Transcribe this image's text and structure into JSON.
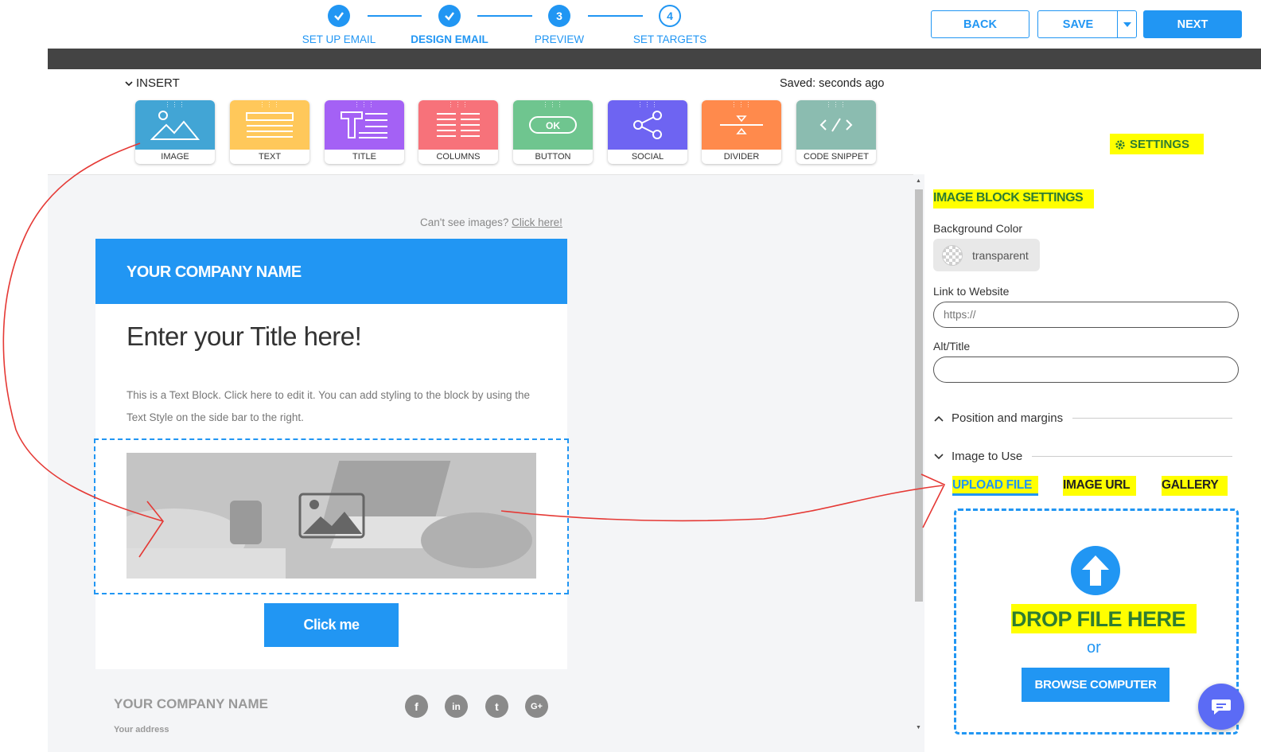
{
  "stepper": {
    "steps": [
      {
        "number": "",
        "label": "SET UP EMAIL",
        "state": "done"
      },
      {
        "number": "",
        "label": "DESIGN EMAIL",
        "state": "current"
      },
      {
        "number": "3",
        "label": "PREVIEW",
        "state": "upcoming"
      },
      {
        "number": "4",
        "label": "SET TARGETS",
        "state": "upcoming"
      }
    ]
  },
  "top_buttons": {
    "back": "BACK",
    "save": "SAVE",
    "next": "NEXT"
  },
  "insert": {
    "toggle_label": "INSERT",
    "saved_status": "Saved: seconds ago",
    "settings_label": "SETTINGS",
    "blocks": [
      {
        "label": "IMAGE",
        "color": "#42A5D5",
        "icon": "image-icon"
      },
      {
        "label": "TEXT",
        "color": "#FFC85A",
        "icon": "text-icon"
      },
      {
        "label": "TITLE",
        "color": "#A461F5",
        "icon": "title-icon"
      },
      {
        "label": "COLUMNS",
        "color": "#F7727A",
        "icon": "columns-icon"
      },
      {
        "label": "BUTTON",
        "color": "#6FC58F",
        "icon": "button-icon"
      },
      {
        "label": "SOCIAL",
        "color": "#6E64F2",
        "icon": "share-icon"
      },
      {
        "label": "DIVIDER",
        "color": "#FF8A4C",
        "icon": "divider-icon"
      },
      {
        "label": "CODE SNIPPET",
        "color": "#8BBCB0",
        "icon": "code-icon"
      }
    ]
  },
  "email": {
    "cant_see": "Can't see images?",
    "click_here": "Click here!",
    "company_name": "YOUR COMPANY NAME",
    "title": "Enter your Title here!",
    "text_block": "This is a Text Block. Click here to edit it. You can add styling to the block by using the Text Style on the side bar to the right.",
    "button_label": "Click me",
    "footer_company": "YOUR COMPANY NAME",
    "footer_address": "Your address",
    "footer_social": [
      "f",
      "in",
      "t",
      "G+"
    ]
  },
  "panel": {
    "title": "IMAGE BLOCK SETTINGS",
    "bg_color_label": "Background Color",
    "bg_color_value": "transparent",
    "link_label": "Link to Website",
    "link_placeholder": "https://",
    "alt_label": "Alt/Title",
    "alt_value": "",
    "position_section": "Position and margins",
    "image_section": "Image to Use",
    "tabs": [
      "UPLOAD FILE",
      "IMAGE URL",
      "GALLERY"
    ],
    "drop_text": "DROP FILE HERE",
    "or_text": "or",
    "browse_label": "BROWSE COMPUTER"
  },
  "colors": {
    "accent": "#2196F3",
    "highlight": "#FFFF00",
    "annotation": "#E53935"
  }
}
